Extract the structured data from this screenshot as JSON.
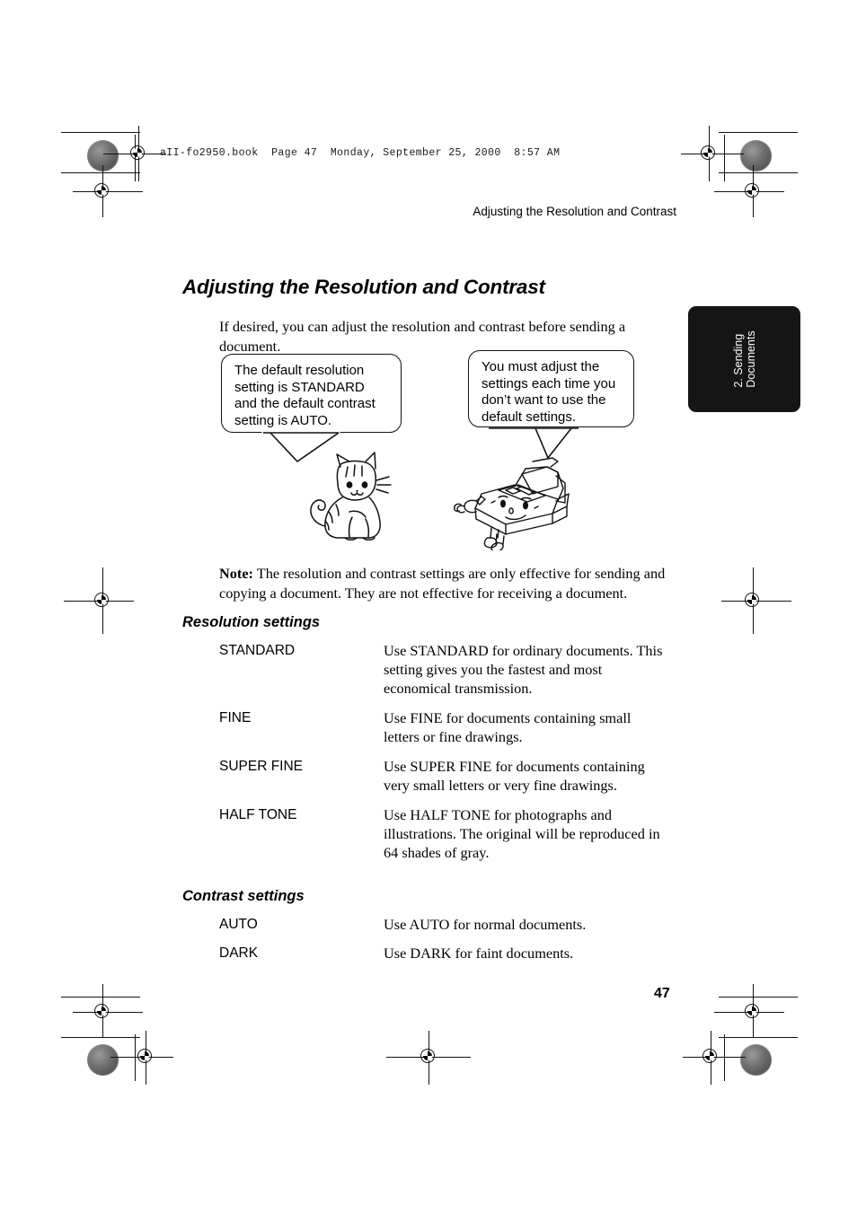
{
  "file_header": "aII-fo2950.book  Page 47  Monday, September 25, 2000  8:57 AM",
  "running_head": "Adjusting the Resolution and Contrast",
  "page_title": "Adjusting the Resolution and Contrast",
  "intro": "If desired, you can adjust the resolution and contrast before sending a document.",
  "side_tab": {
    "line1": "2. Sending",
    "line2": "Documents",
    "background": "#151515",
    "text_color": "#ffffff"
  },
  "balloons": [
    {
      "text": "The default resolution setting is STANDARD and the default contrast setting is AUTO."
    },
    {
      "text": "You must adjust the settings each time you don’t want to use the default settings."
    }
  ],
  "illustrations": [
    {
      "name": "cat-illustration"
    },
    {
      "name": "fax-machine-illustration"
    }
  ],
  "note": {
    "label": "Note:",
    "text": " The resolution and contrast settings are only effective for sending and copying a document. They are not effective for receiving a document."
  },
  "resolution_section": {
    "heading": "Resolution settings",
    "rows": [
      {
        "term": "STANDARD",
        "desc": "Use STANDARD for ordinary documents. This setting gives you the fastest and most economical transmission."
      },
      {
        "term": "FINE",
        "desc": "Use FINE for documents containing small letters or fine drawings."
      },
      {
        "term": "SUPER FINE",
        "desc": "Use SUPER FINE for documents containing very small letters or very fine drawings."
      },
      {
        "term": "HALF TONE",
        "desc": "Use HALF TONE for photographs and illustrations. The original will be reproduced in 64 shades of gray."
      }
    ]
  },
  "contrast_section": {
    "heading": "Contrast settings",
    "rows": [
      {
        "term": "AUTO",
        "desc": "Use AUTO for normal documents."
      },
      {
        "term": "DARK",
        "desc": "Use DARK for faint documents."
      }
    ]
  },
  "page_number": "47"
}
